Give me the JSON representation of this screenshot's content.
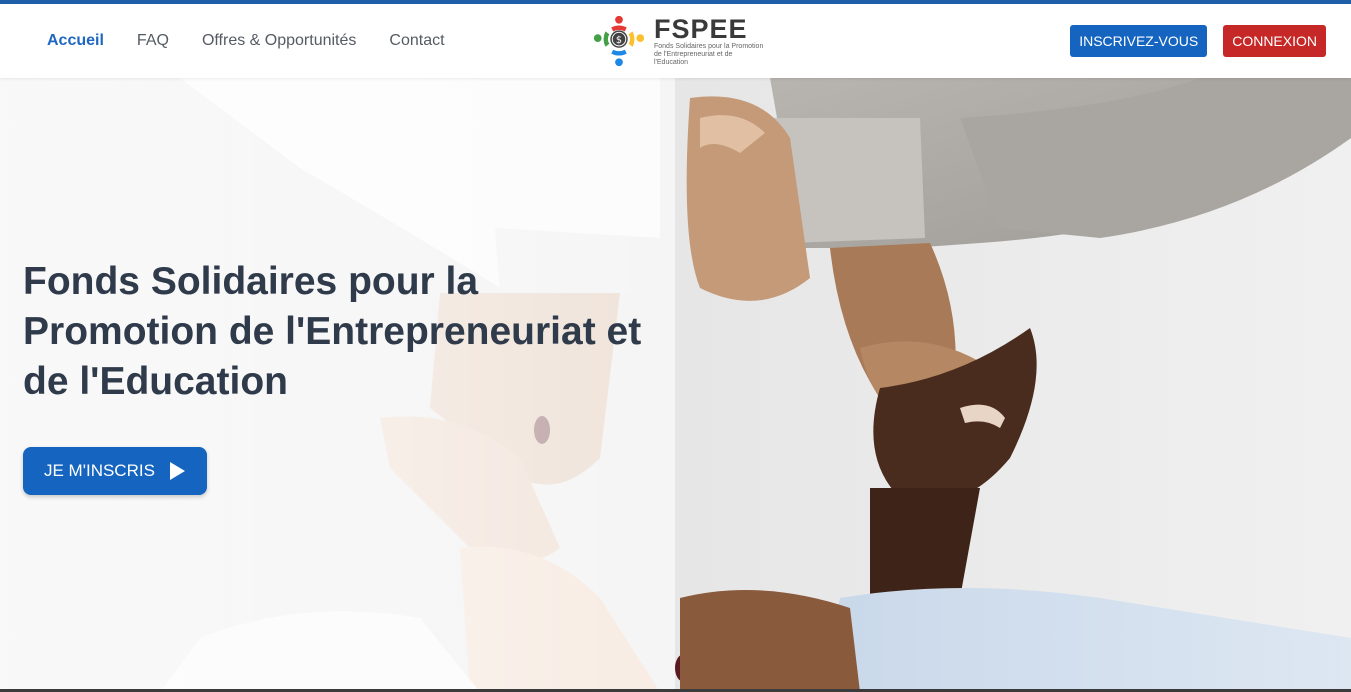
{
  "nav": {
    "links": [
      {
        "label": "Accueil",
        "active": true
      },
      {
        "label": "FAQ",
        "active": false
      },
      {
        "label": "Offres & Opportunités",
        "active": false
      },
      {
        "label": "Contact",
        "active": false
      }
    ],
    "signup_label": "INSCRIVEZ-VOUS",
    "login_label": "CONNEXION"
  },
  "brand": {
    "name": "FSPEE",
    "subtitle": "Fonds Solidaires pour la Promotion de l'Entrepreneuriat et de l'Education",
    "logo_icon": "people-circle-coin-logo"
  },
  "hero": {
    "title": "Fonds Solidaires pour la Promotion de l'Entrepreneuriat et de l'Education",
    "cta_label": "JE M'INSCRIS",
    "cta_icon": "play-icon",
    "background": "hands-holding-wrists-photo"
  },
  "colors": {
    "primary": "#1565c0",
    "danger": "#c62828",
    "active_link": "#1f68c2",
    "title": "#2f3a4a"
  }
}
